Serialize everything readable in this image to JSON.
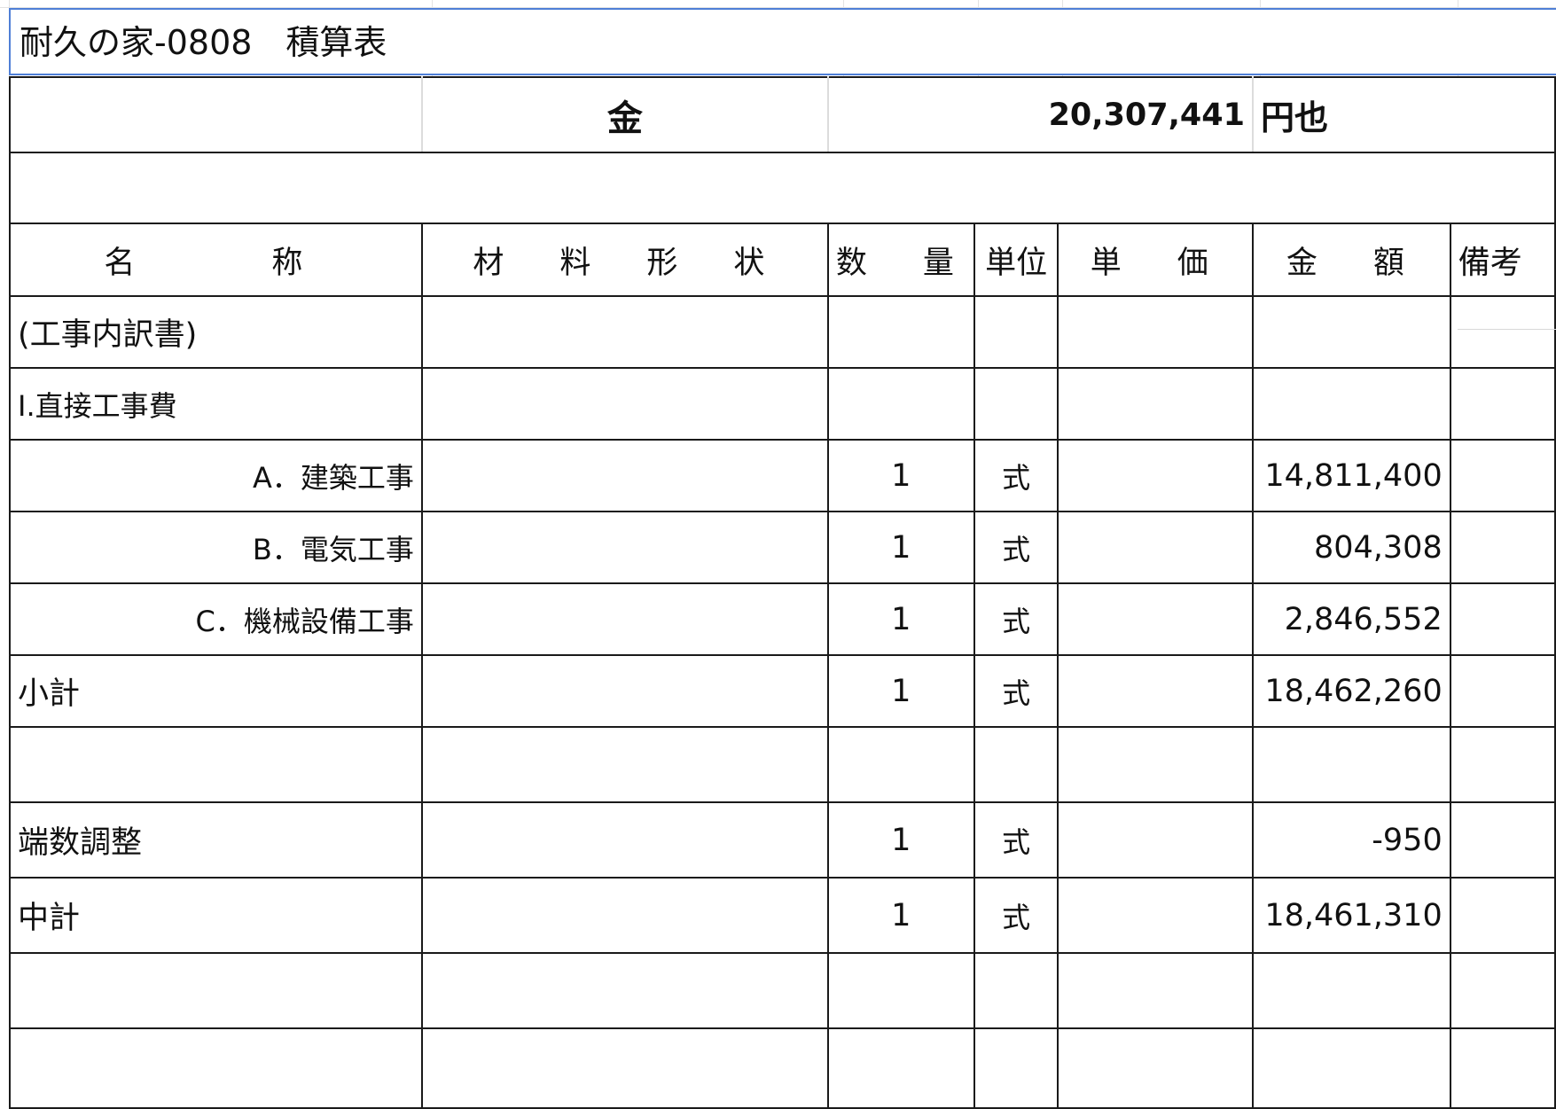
{
  "sheet": {
    "title": "耐久の家-0808　積算表",
    "total_label": "金",
    "total_value": "20,307,441",
    "total_suffix": "円也"
  },
  "columns": [
    "名　　称",
    "材　料　形　状",
    "数　量",
    "単位",
    "単　価",
    "金　額",
    "備考"
  ],
  "rows": [
    {
      "name": "(工事内訳書)",
      "spec": "",
      "qty": "",
      "unit": "",
      "price": "",
      "amount": "",
      "align": "left"
    },
    {
      "name": "Ⅰ.直接工事費",
      "spec": "",
      "qty": "",
      "unit": "",
      "price": "",
      "amount": "",
      "align": "left"
    },
    {
      "name": "A．建築工事",
      "spec": "",
      "qty": "1",
      "unit": "式",
      "price": "",
      "amount": "14,811,400",
      "align": "right"
    },
    {
      "name": "B．電気工事",
      "spec": "",
      "qty": "1",
      "unit": "式",
      "price": "",
      "amount": "804,308",
      "align": "right"
    },
    {
      "name": "C．機械設備工事",
      "spec": "",
      "qty": "1",
      "unit": "式",
      "price": "",
      "amount": "2,846,552",
      "align": "right"
    },
    {
      "name": "小計",
      "spec": "",
      "qty": "1",
      "unit": "式",
      "price": "",
      "amount": "18,462,260",
      "align": "left"
    },
    {
      "name": "",
      "spec": "",
      "qty": "",
      "unit": "",
      "price": "",
      "amount": "",
      "align": "left"
    },
    {
      "name": "端数調整",
      "spec": "",
      "qty": "1",
      "unit": "式",
      "price": "",
      "amount": "-950",
      "align": "left"
    },
    {
      "name": "中計",
      "spec": "",
      "qty": "1",
      "unit": "式",
      "price": "",
      "amount": "18,461,310",
      "align": "left"
    },
    {
      "name": "",
      "spec": "",
      "qty": "",
      "unit": "",
      "price": "",
      "amount": "",
      "align": "left"
    },
    {
      "name": "",
      "spec": "",
      "qty": "",
      "unit": "",
      "price": "",
      "amount": "",
      "align": "left"
    }
  ]
}
